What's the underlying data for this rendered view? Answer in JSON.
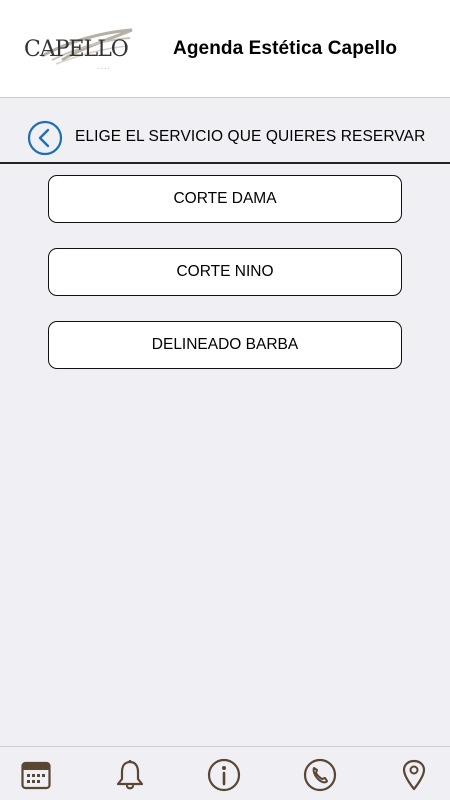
{
  "header": {
    "app_title": "Agenda Estética Capello",
    "logo_text": "CAPELLO",
    "logo_icon": "capello-logo"
  },
  "subheader": {
    "title": "ELIGE EL SERVICIO QUE QUIERES RESERVAR",
    "back_icon": "chevron-left-circle-icon"
  },
  "services": [
    {
      "label": "CORTE DAMA"
    },
    {
      "label": "CORTE NINO"
    },
    {
      "label": "DELINEADO BARBA"
    }
  ],
  "tabbar": {
    "items": [
      {
        "icon": "calendar-icon"
      },
      {
        "icon": "bell-icon"
      },
      {
        "icon": "info-icon"
      },
      {
        "icon": "phone-icon"
      },
      {
        "icon": "location-pin-icon"
      }
    ]
  },
  "colors": {
    "accent_blue": "#1f6fb5",
    "icon_brown": "#5a4634",
    "background": "#efeff4"
  }
}
